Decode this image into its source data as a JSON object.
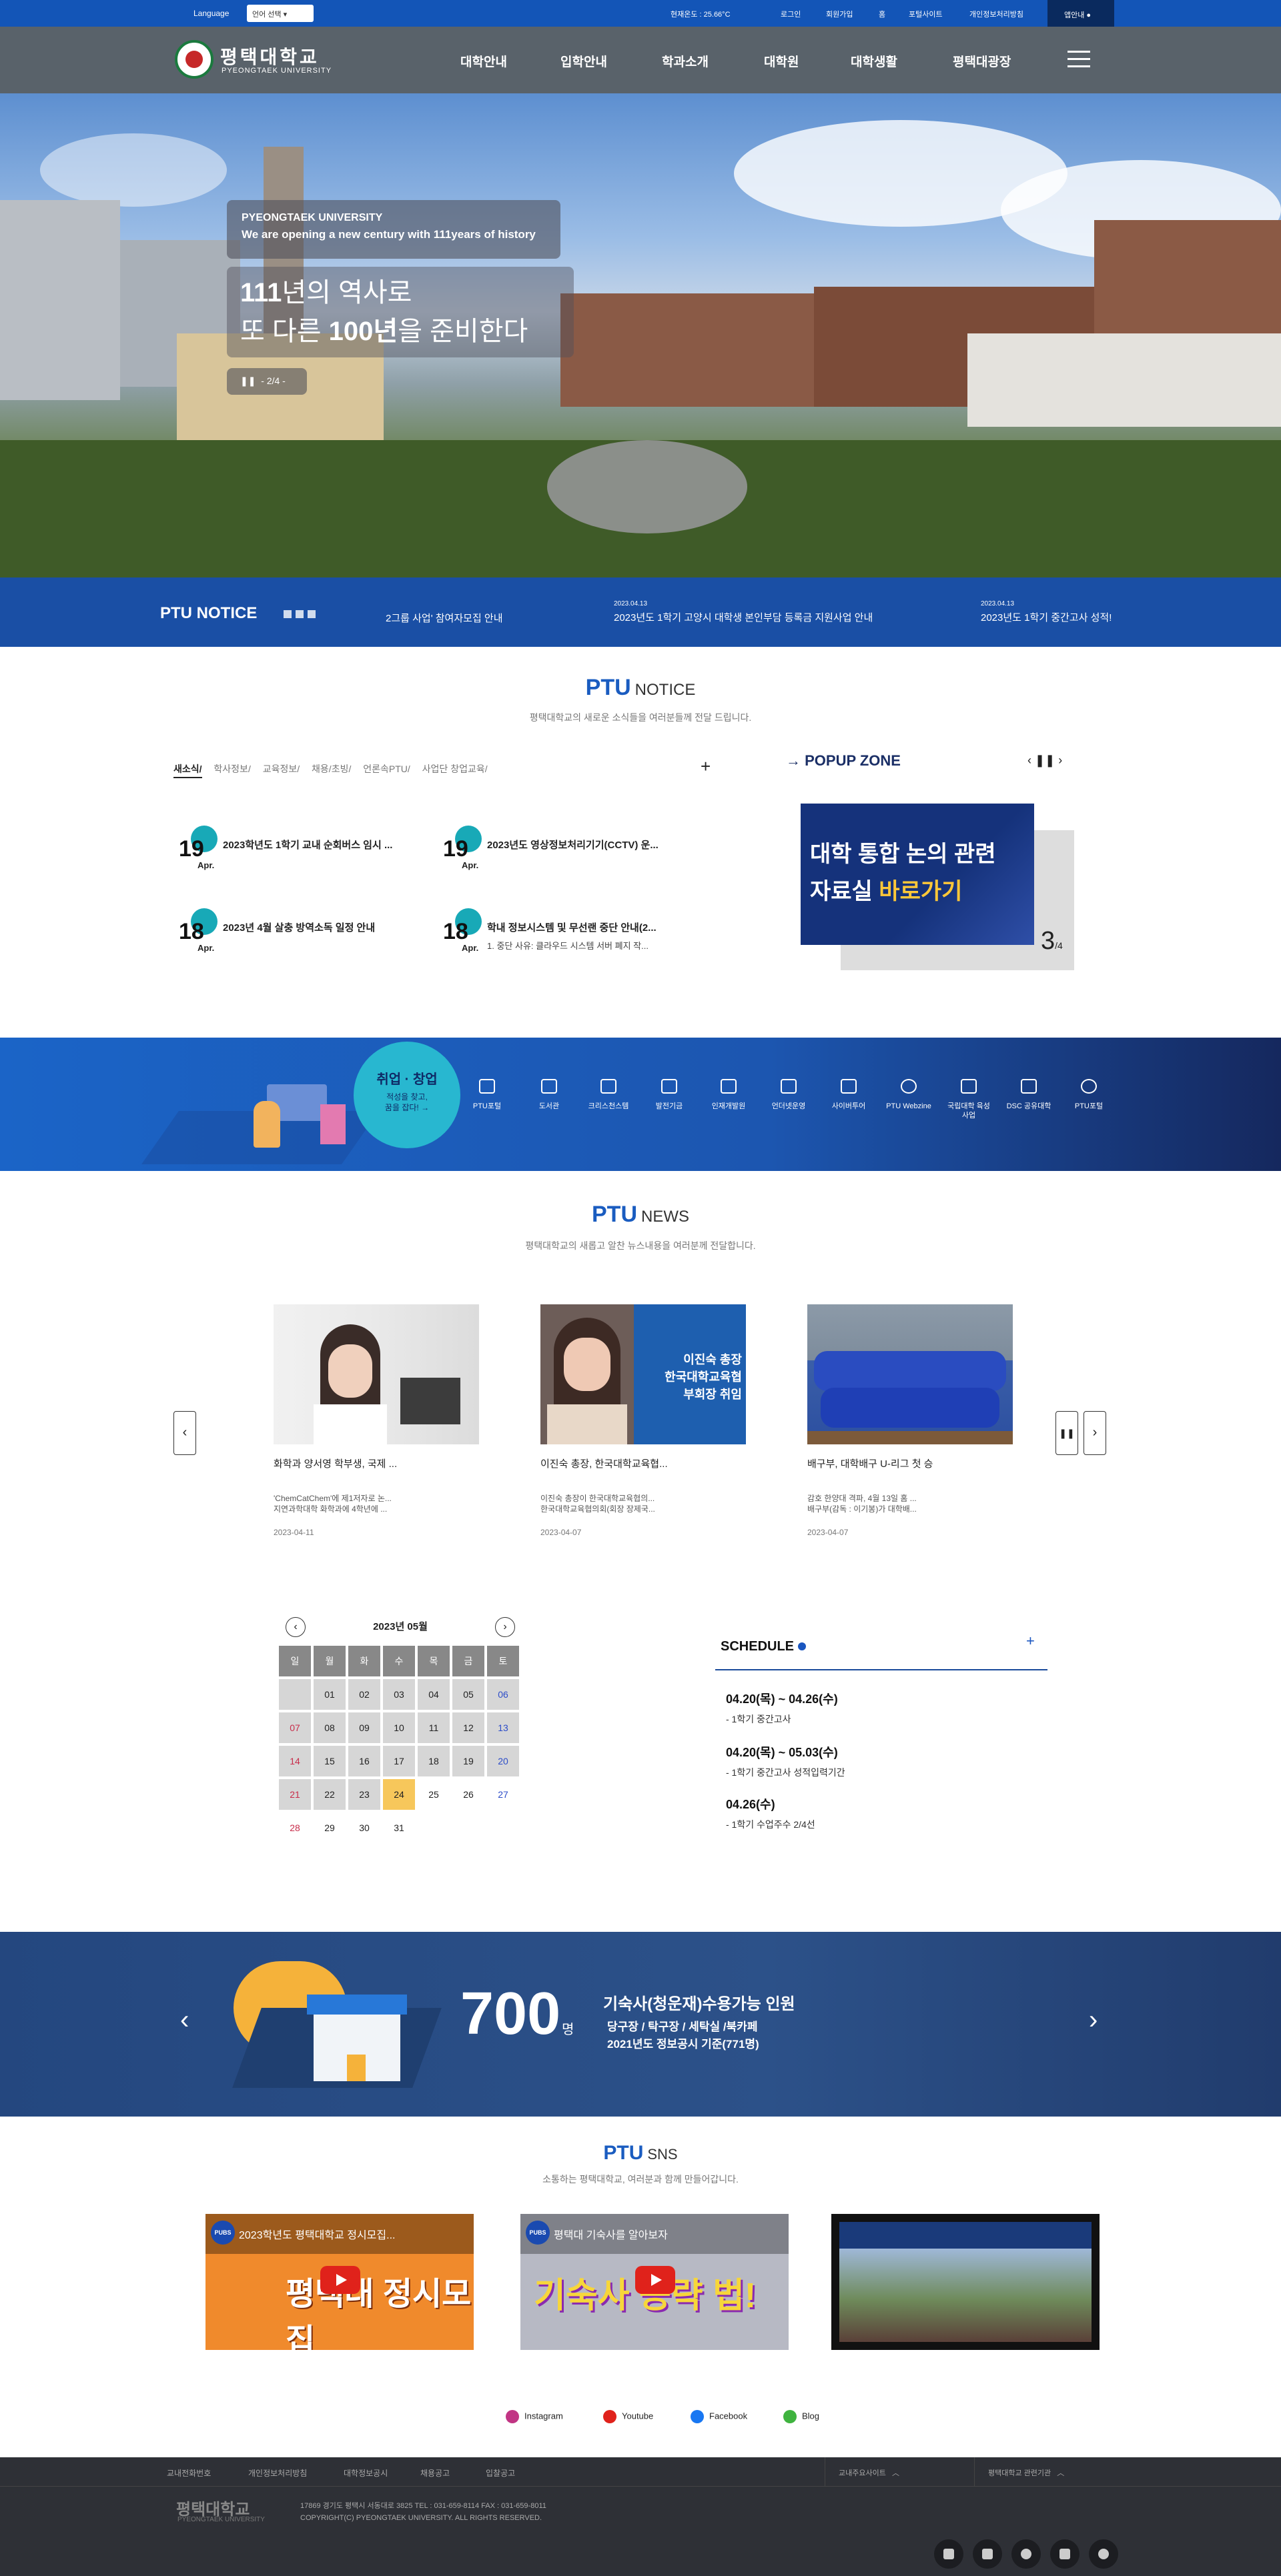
{
  "topbar": {
    "language_label": "Language",
    "language_select": "언어 선택",
    "weather": "현재온도 : 25.66°C",
    "login": "로그인",
    "join": "회원가입",
    "home": "홈",
    "portal": "포털사이트",
    "privacy": "개인정보처리방침",
    "app": "앱안내"
  },
  "header": {
    "logo_ko": "평택대학교",
    "logo_en": "PYEONGTAEK UNIVERSITY",
    "nav": [
      "대학안내",
      "입학안내",
      "학과소개",
      "대학원",
      "대학생활",
      "평택대광장"
    ]
  },
  "hero": {
    "caption_line1": "PYEONGTAEK UNIVERSITY",
    "caption_line2": "We are opening a new century with 111years of history",
    "title_a": "111",
    "title_b": "년의 역사로",
    "title_c": "또 다른 ",
    "title_d": "100년",
    "title_e": "을 준비한다",
    "counter": "2/4"
  },
  "notice_strip": {
    "label": "PTU NOTICE",
    "items": [
      {
        "date": "",
        "title": "2그룹 사업' 참여자모집 안내"
      },
      {
        "date": "2023.04.13",
        "title": "2023년도 1학기 고양시 대학생 본인부담 등록금 지원사업 안내"
      },
      {
        "date": "2023.04.13",
        "title": "2023년도 1학기 중간고사 성적!"
      }
    ]
  },
  "notice": {
    "title": "PTU",
    "title2": "NOTICE",
    "subtitle": "평택대학교의 새로운 소식들을 여러분들께 전달 드립니다.",
    "tabs": [
      "새소식/",
      "학사정보/",
      "교육정보/",
      "채용/초빙/",
      "언론속PTU/",
      "사업단 창업교육/"
    ],
    "items": [
      {
        "day": "19",
        "month": "Apr.",
        "title": "2023학년도 1학기 교내 순회버스 임시 ...",
        "sub": ""
      },
      {
        "day": "19",
        "month": "Apr.",
        "title": "2023년도 영상정보처리기기(CCTV) 운...",
        "sub": ""
      },
      {
        "day": "18",
        "month": "Apr.",
        "title": "2023년 4월 살충 방역소독 일정 안내",
        "sub": ""
      },
      {
        "day": "18",
        "month": "Apr.",
        "title": "학내 정보시스템 및 무선랜 중단 안내(2...",
        "sub": "1. 중단 사유: 클라우드 시스템 서버 폐지 작..."
      }
    ]
  },
  "popup": {
    "title": "POPUP ZONE",
    "card_line1": "대학 통합 논의 관련",
    "card_line2a": "자료실 ",
    "card_line2b": "바로가기",
    "count": "3",
    "total": "/4"
  },
  "quick": {
    "bubble_title": "취업 · 창업",
    "bubble_text1": "적성을 찾고,",
    "bubble_text2": "꿈을 잡다!",
    "items": [
      "PTU포털",
      "도서관",
      "크리스천스템",
      "발전기금",
      "인재개발원",
      "언더넷운영",
      "사이버투어",
      "PTU Webzine",
      "국립대학 육성사업",
      "DSC 공유대학",
      "PTU포털"
    ]
  },
  "news": {
    "title": "PTU",
    "title2": "NEWS",
    "subtitle": "평택대학교의 새롭고 알찬 뉴스내용을 여러분께 전달합니다.",
    "items": [
      {
        "title": "화학과 양서영 학부생, 국제 ...",
        "sub1": "'ChemCatChem'에 제1저자로 논...",
        "sub2": "지연과학대학 화학과에 4학년에 ...",
        "date": "2023-04-11"
      },
      {
        "title": "이진숙 총장, 한국대학교육협...",
        "sub1": "이진숙 총장이 한국대학교육협의...",
        "sub2": "한국대학교육협의회(회장 장제국...",
        "date": "2023-04-07",
        "overlay1": "이진숙 총장",
        "overlay2": "한국대학교육협",
        "overlay3": "부회장 취임"
      },
      {
        "title": "배구부, 대학배구 U-리그 첫 승",
        "sub1": "감호 한양대 격파, 4월 13일 홈 ...",
        "sub2": "배구부(감독 : 이기봉)가 대학배...",
        "date": "2023-04-07"
      }
    ]
  },
  "calendar": {
    "month": "2023년 05월",
    "headers": [
      "일",
      "월",
      "화",
      "수",
      "목",
      "금",
      "토"
    ],
    "rows": [
      [
        "",
        "01",
        "02",
        "03",
        "04",
        "05",
        "06"
      ],
      [
        "07",
        "08",
        "09",
        "10",
        "11",
        "12",
        "13"
      ],
      [
        "14",
        "15",
        "16",
        "17",
        "18",
        "19",
        "20"
      ],
      [
        "21",
        "22",
        "23",
        "24",
        "25",
        "26",
        "27"
      ],
      [
        "28",
        "29",
        "30",
        "31",
        "",
        "",
        ""
      ]
    ]
  },
  "schedule": {
    "title": "SCHEDULE",
    "items": [
      {
        "date": "04.20(목) ~ 04.26(수)",
        "desc": "- 1학기 중간고사"
      },
      {
        "date": "04.20(목) ~ 05.03(수)",
        "desc": "- 1학기 중간고사 성적입력기간"
      },
      {
        "date": "04.26(수)",
        "desc": "- 1학기 수업주수 2/4선"
      }
    ]
  },
  "dorm": {
    "number": "700",
    "unit": "명",
    "title": "기숙사(청운재)수용가능 인원",
    "line1": "당구장 / 탁구장 / 세탁실 /북카페",
    "line2": "2021년도 정보공시 기준(771명)"
  },
  "sns": {
    "title": "PTU",
    "title2": "SNS",
    "subtitle": "소통하는 평택대학교, 여러분과 함께 만들어갑니다.",
    "videos": [
      {
        "title": "2023학년도 평택대학교 정시모집...",
        "big": "평택대 정시모집"
      },
      {
        "title": "평택대 기숙사를 알아보자",
        "big": "기숙사 공략 법!"
      },
      {
        "title": "",
        "big": ""
      }
    ],
    "links": [
      "Instagram",
      "Youtube",
      "Facebook",
      "Blog"
    ]
  },
  "footer": {
    "links": [
      "교내전화번호",
      "개인정보처리방침",
      "대학정보공시",
      "채용공고",
      "입찰공고"
    ],
    "select1": "교내주요사이트",
    "select2": "평택대학교 관련기관",
    "logo": "평택대학교",
    "logo_en": "PYEONGTAEK UNIVERSITY",
    "address": "17869 경기도 평택시 서동대로 3825 TEL : 031-659-8114 FAX : 031-659-8011",
    "copyright": "COPYRIGHT(C) PYEONGTAEK UNIVERSITY. ALL RIGHTS RESERVED."
  }
}
